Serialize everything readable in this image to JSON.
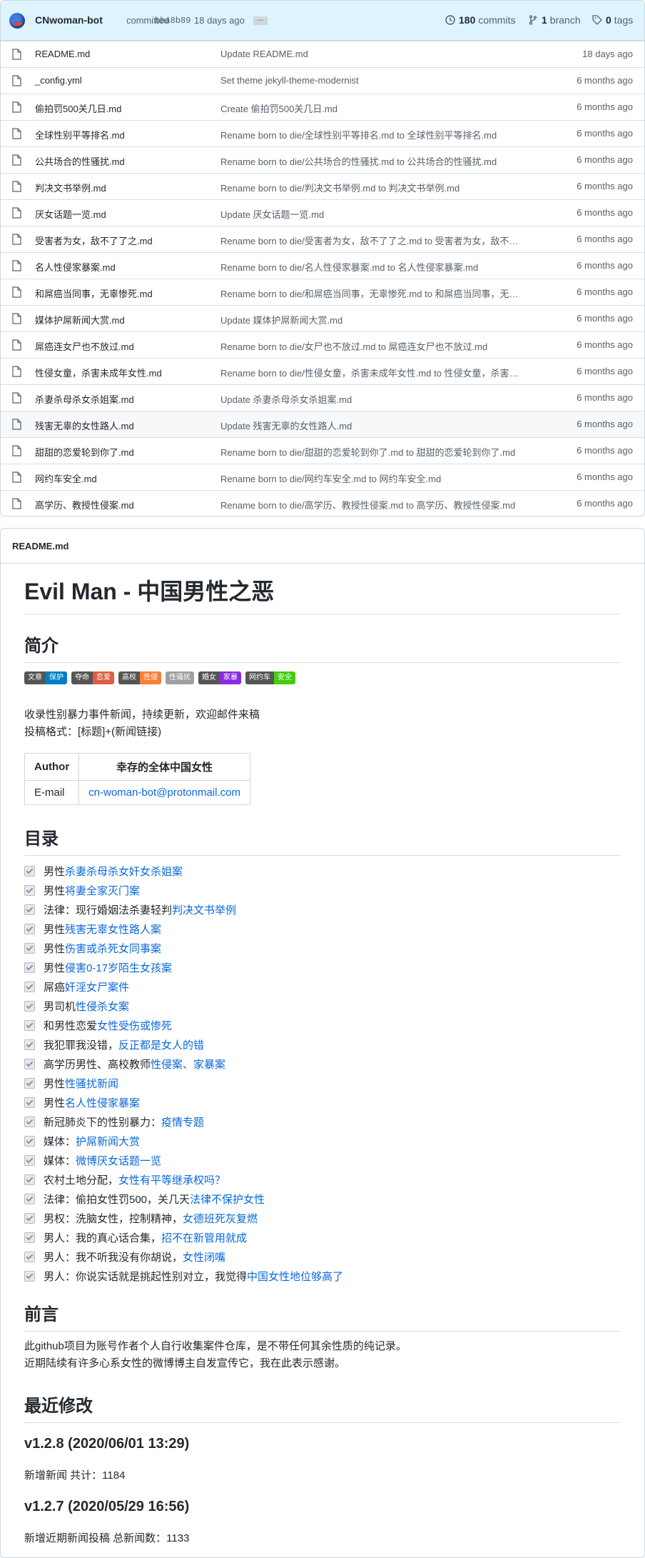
{
  "commit_bar": {
    "author": "CNwoman-bot",
    "action": "committed",
    "sha": "bba8b89",
    "age": "18 days ago",
    "ellipsis": "…",
    "commits_count": "180",
    "commits_label": "commits",
    "branch_count": "1",
    "branch_label": "branch",
    "tags_count": "0",
    "tags_label": "tags"
  },
  "files": [
    {
      "name": "README.md",
      "message": "Update README.md",
      "age": "18 days ago"
    },
    {
      "name": "_config.yml",
      "message": "Set theme jekyll-theme-modernist",
      "age": "6 months ago"
    },
    {
      "name": "偷拍罚500关几日.md",
      "message": "Create 偷拍罚500关几日.md",
      "age": "6 months ago"
    },
    {
      "name": "全球性别平等排名.md",
      "message": "Rename born to die/全球性别平等排名.md to 全球性别平等排名.md",
      "age": "6 months ago"
    },
    {
      "name": "公共场合的性骚扰.md",
      "message": "Rename born to die/公共场合的性骚扰.md to 公共场合的性骚扰.md",
      "age": "6 months ago"
    },
    {
      "name": "判决文书举例.md",
      "message": "Rename born to die/判决文书举例.md to 判决文书举例.md",
      "age": "6 months ago"
    },
    {
      "name": "厌女话题一览.md",
      "message": "Update 厌女话题一览.md",
      "age": "6 months ago"
    },
    {
      "name": "受害者为女，敌不了了之.md",
      "message": "Rename born to die/受害者为女，敌不了了之.md to 受害者为女，敌不…",
      "age": "6 months ago"
    },
    {
      "name": "名人性侵家暴案.md",
      "message": "Rename born to die/名人性侵家暴案.md to 名人性侵家暴案.md",
      "age": "6 months ago"
    },
    {
      "name": "和屌癌当同事，无辜惨死.md",
      "message": "Rename born to die/和屌癌当同事，无辜惨死.md to 和屌癌当同事，无…",
      "age": "6 months ago"
    },
    {
      "name": "媒体护屌新闻大赏.md",
      "message": "Update 媒体护屌新闻大赏.md",
      "age": "6 months ago"
    },
    {
      "name": "屌癌连女尸也不放过.md",
      "message": "Rename born to die/女尸也不放过.md to 屌癌连女尸也不放过.md",
      "age": "6 months ago"
    },
    {
      "name": "性侵女童，杀害未成年女性.md",
      "message": "Rename born to die/性侵女童，杀害未成年女性.md to 性侵女童，杀害…",
      "age": "6 months ago"
    },
    {
      "name": "杀妻杀母杀女杀姐案.md",
      "message": "Update 杀妻杀母杀女杀姐案.md",
      "age": "6 months ago"
    },
    {
      "name": "残害无辜的女性路人.md",
      "message": "Update 残害无辜的女性路人.md",
      "age": "6 months ago"
    },
    {
      "name": "甜甜的恋爱轮到你了.md",
      "message": "Rename born to die/甜甜的恋爱轮到你了.md to 甜甜的恋爱轮到你了.md",
      "age": "6 months ago"
    },
    {
      "name": "网约车安全.md",
      "message": "Rename born to die/网约车安全.md to 网约车安全.md",
      "age": "6 months ago"
    },
    {
      "name": "高学历、教授性侵案.md",
      "message": "Rename born to die/高学历、教授性侵案.md to 高学历、教授性侵案.md",
      "age": "6 months ago"
    }
  ],
  "readme": {
    "filename": "README.md",
    "title": "Evil Man - 中国男性之恶",
    "intro_heading": "简介",
    "badges": [
      {
        "left": "文章",
        "right": "保护",
        "color": "#007ec6"
      },
      {
        "left": "夺命",
        "right": "恋爱",
        "color": "#e05d44"
      },
      {
        "left": "高校",
        "right": "性侵",
        "color": "#fe7d37"
      },
      {
        "left": "性骚扰",
        "right": "",
        "color": "#9f9f9f"
      },
      {
        "left": "婚女",
        "right": "家暴",
        "color": "#8a2be2"
      },
      {
        "left": "网约车",
        "right": "安全",
        "color": "#4c1"
      }
    ],
    "intro_line1": "收录性别暴力事件新闻，持续更新，欢迎邮件来稿",
    "intro_line2": "投稿格式：[标题]+(新闻链接)",
    "table": {
      "h1": "Author",
      "h2": "幸存的全体中国女性",
      "c1": "E-mail",
      "c2": "cn-woman-bot@protonmail.com"
    },
    "toc_heading": "目录",
    "toc": [
      {
        "prefix": "男性",
        "link": "杀妻杀母杀女奸女杀姐案"
      },
      {
        "prefix": "男性",
        "link": "将妻全家灭门案"
      },
      {
        "prefix": "法律：现行婚姻法杀妻轻判",
        "link": "判决文书举例"
      },
      {
        "prefix": "男性",
        "link": "残害无辜女性路人案"
      },
      {
        "prefix": "男性",
        "link": "伤害或杀死女同事案"
      },
      {
        "prefix": "男性",
        "link": "侵害0-17岁陌生女孩案"
      },
      {
        "prefix": "屌癌",
        "link": "奸淫女尸案件"
      },
      {
        "prefix": "男司机",
        "link": "性侵杀女案"
      },
      {
        "prefix": "和男性恋爱",
        "link": "女性受伤或惨死"
      },
      {
        "prefix": "我犯罪我没错，",
        "link": "反正都是女人的错"
      },
      {
        "prefix": "高学历男性、高校教师",
        "link": "性侵案、家暴案"
      },
      {
        "prefix": "男性",
        "link": "性骚扰新闻"
      },
      {
        "prefix": "男性",
        "link": "名人性侵家暴案"
      },
      {
        "prefix": "新冠肺炎下的性别暴力：",
        "link": "疫情专题"
      },
      {
        "prefix": "媒体：",
        "link": "护屌新闻大赏"
      },
      {
        "prefix": "媒体：",
        "link": "微博厌女话题一览"
      },
      {
        "prefix": "农村土地分配，",
        "link": "女性有平等继承权吗？"
      },
      {
        "prefix": "法律：偷拍女性罚500，关几天",
        "link": "法律不保护女性"
      },
      {
        "prefix": "男权：洗脑女性，控制精神，",
        "link": "女德班死灰复燃"
      },
      {
        "prefix": "男人：我的真心话合集，",
        "link": "招不在新管用就成"
      },
      {
        "prefix": "男人：我不听我没有你胡说，",
        "link": "女性闭嘴"
      },
      {
        "prefix": "男人：你说实话就是挑起性别对立，我觉得",
        "link": "中国女性地位够高了"
      }
    ],
    "preface_heading": "前言",
    "preface_line1": "此github项目为账号作者个人自行收集案件仓库，是不带任何其余性质的纯记录。",
    "preface_line2": "近期陆续有许多心系女性的微博博主自发宣传它，我在此表示感谢。",
    "recent_heading": "最近修改",
    "v1_heading": "v1.2.8 (2020/06/01 13:29)",
    "v1_text": "新增新闻 共计：1184",
    "v2_heading": "v1.2.7 (2020/05/29 16:56)",
    "v2_text": "新增近期新闻投稿 总新闻数：1133"
  }
}
